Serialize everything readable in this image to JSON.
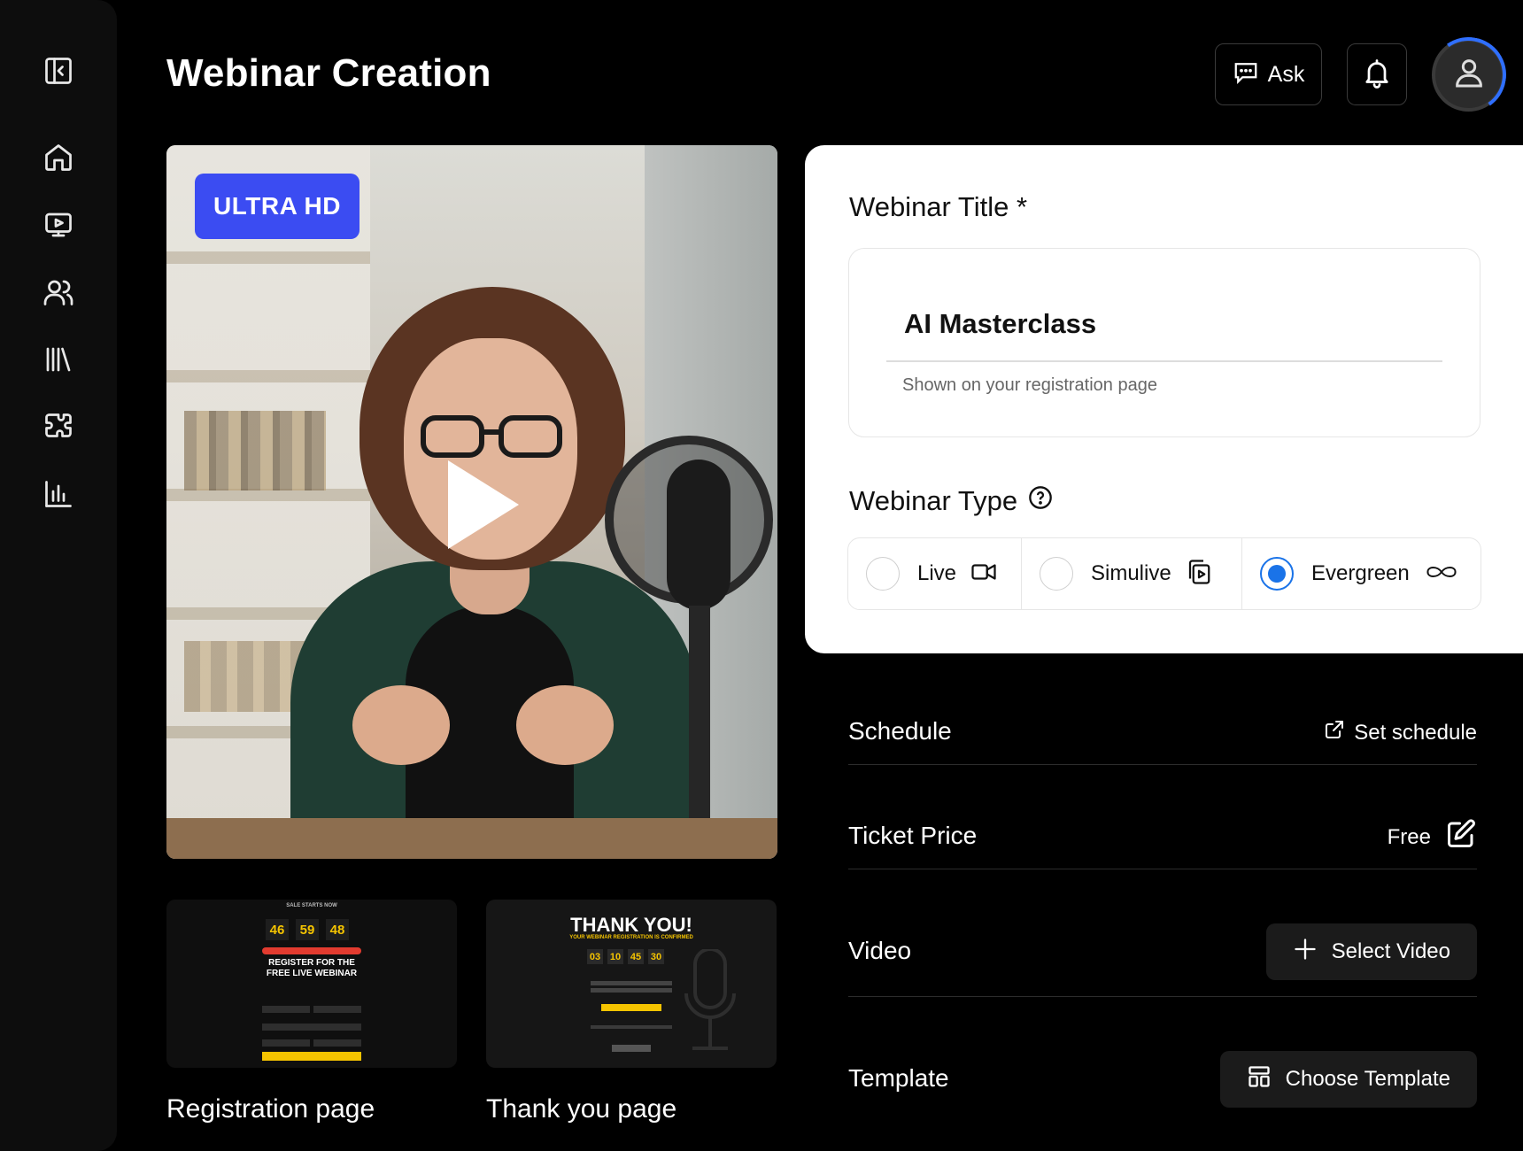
{
  "header": {
    "title": "Webinar Creation",
    "ask_label": "Ask"
  },
  "sidebar": {
    "items": [
      {
        "icon": "collapse-sidebar-icon"
      },
      {
        "icon": "home-icon"
      },
      {
        "icon": "webinar-screen-icon"
      },
      {
        "icon": "users-icon"
      },
      {
        "icon": "library-icon"
      },
      {
        "icon": "integrations-puzzle-icon"
      },
      {
        "icon": "analytics-chart-icon"
      }
    ]
  },
  "video": {
    "badge": "ULTRA HD"
  },
  "thumbnails": [
    {
      "label": "Registration page",
      "preview": {
        "top": "SALE STARTS NOW",
        "timer": [
          "46",
          "59",
          "48"
        ],
        "headline_1": "REGISTER FOR THE",
        "headline_2": "FREE LIVE WEBINAR"
      }
    },
    {
      "label": "Thank you page",
      "preview": {
        "headline": "THANK YOU!",
        "subline": "YOUR WEBINAR REGISTRATION IS CONFIRMED",
        "timer": [
          "03",
          "10",
          "45",
          "30"
        ]
      }
    }
  ],
  "form": {
    "title_label": "Webinar Title *",
    "title_value": "AI Masterclass",
    "title_helper": "Shown on your registration page",
    "type_label": "Webinar Type",
    "type_options": [
      {
        "label": "Live",
        "icon": "video-camera-icon",
        "selected": false
      },
      {
        "label": "Simulive",
        "icon": "play-copy-icon",
        "selected": false
      },
      {
        "label": "Evergreen",
        "icon": "infinity-icon",
        "selected": true
      }
    ]
  },
  "settings": {
    "schedule": {
      "label": "Schedule",
      "action": "Set schedule"
    },
    "ticket_price": {
      "label": "Ticket Price",
      "value": "Free"
    },
    "video": {
      "label": "Video",
      "action": "Select Video"
    },
    "template": {
      "label": "Template",
      "action": "Choose Template"
    }
  },
  "colors": {
    "accent": "#3b4cf2",
    "radio_selected": "#1a73e8",
    "countdown_yellow": "#f5c400",
    "background": "#000000"
  }
}
